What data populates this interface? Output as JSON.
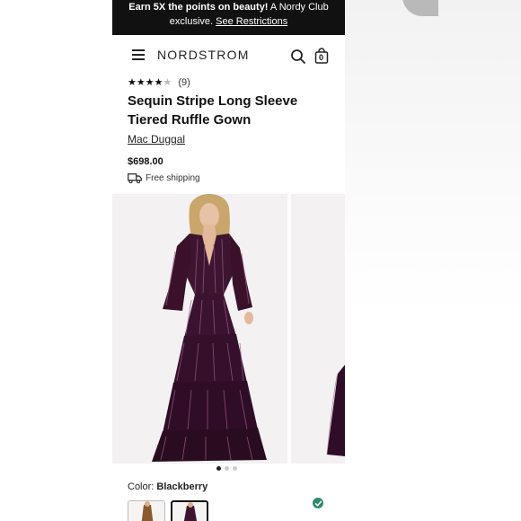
{
  "promo": {
    "bold": "Earn 5X the points on beauty!",
    "text": " A Nordy Club exclusive.",
    "link": "See Restrictions"
  },
  "header": {
    "logo": "NORDSTROM",
    "menu_icon": "hamburger-menu-icon",
    "search_icon": "search-icon",
    "bag_icon": "shopping-bag-icon",
    "bag_count": "0"
  },
  "product": {
    "rating_stars": 4,
    "rating_max": 5,
    "rating_count": "(9)",
    "title": "Sequin Stripe Long Sleeve Tiered Ruffle Gown",
    "brand": "Mac Duggal",
    "price": "$698.00",
    "shipping": "Free shipping",
    "color_label": "Color:",
    "color_value": "Blackberry"
  },
  "gallery": {
    "image_count": 3,
    "active_index": 0
  },
  "colors": {
    "dress": "#3e1530",
    "dress_dark": "#2a0c20",
    "sequin": "#9a5b87",
    "check": "#2e8a6b"
  }
}
